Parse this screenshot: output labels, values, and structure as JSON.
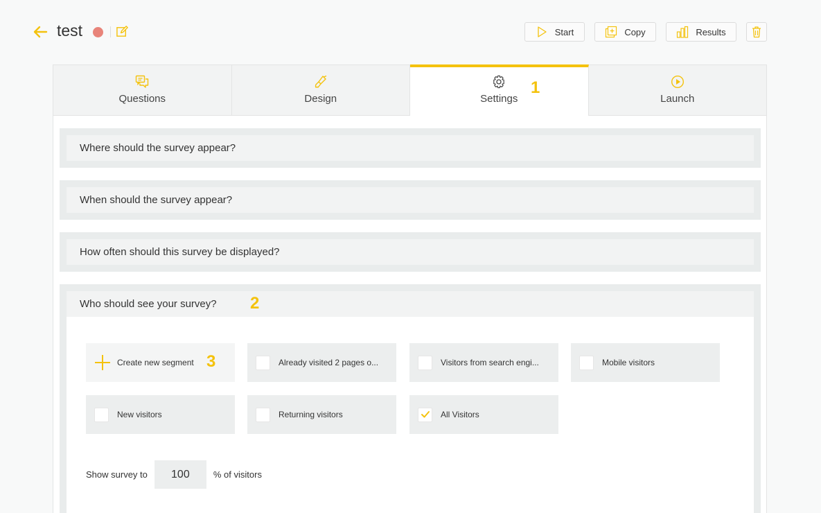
{
  "header": {
    "title": "test",
    "status_color": "#e8847a",
    "accent_color": "#f4c20d",
    "buttons": {
      "start": "Start",
      "copy": "Copy",
      "results": "Results"
    }
  },
  "tabs": [
    {
      "label": "Questions",
      "icon": "chat-icon"
    },
    {
      "label": "Design",
      "icon": "brush-icon"
    },
    {
      "label": "Settings",
      "icon": "gear-icon",
      "active": true
    },
    {
      "label": "Launch",
      "icon": "play-circle-icon"
    }
  ],
  "annotations": [
    "1",
    "2",
    "3"
  ],
  "sections": [
    {
      "title": "Where should the survey appear?"
    },
    {
      "title": "When should the survey appear?"
    },
    {
      "title": "How often should this survey be displayed?"
    },
    {
      "title": "Who should see your survey?"
    }
  ],
  "segments": {
    "create_label": "Create new segment",
    "items": [
      {
        "label": "Already visited 2 pages o...",
        "checked": false
      },
      {
        "label": "Visitors from search engi...",
        "checked": false
      },
      {
        "label": "Mobile visitors",
        "checked": false
      },
      {
        "label": "New visitors",
        "checked": false
      },
      {
        "label": "Returning visitors",
        "checked": false
      },
      {
        "label": "All Visitors",
        "checked": true
      }
    ]
  },
  "show_survey": {
    "prefix": "Show survey to",
    "value": "100",
    "suffix": "% of visitors"
  }
}
